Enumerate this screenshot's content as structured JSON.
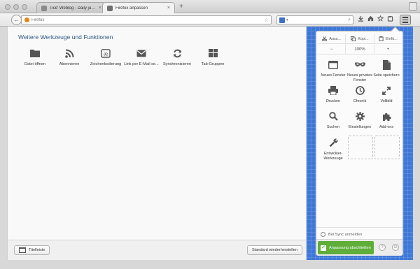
{
  "window": {
    "tabs": [
      {
        "label": "Tice' Weblog - Daily junk ...",
        "close": "×"
      },
      {
        "label": "Firefox anpassen",
        "close": "×"
      }
    ],
    "new_tab": "+"
  },
  "toolbar": {
    "back": "←",
    "url_placeholder": "Firefox",
    "bookmark_star": "☆",
    "search_caret": "▾",
    "search_glass": "⌕",
    "icons": [
      "download-icon",
      "home-icon",
      "bookmark-icon",
      "reading-list-icon"
    ]
  },
  "palette": {
    "title": "Weitere Werkzeuge und Funktionen",
    "tools": [
      {
        "label": "Datei öffnen",
        "icon": "folder-icon"
      },
      {
        "label": "Abonnieren",
        "icon": "rss-icon"
      },
      {
        "label": "Zeichenkodierung",
        "icon": "encoding-icon"
      },
      {
        "label": "Link per E-Mail se...",
        "icon": "mail-icon"
      },
      {
        "label": "Synchronisieren",
        "icon": "sync-icon"
      },
      {
        "label": "Tab-Gruppen",
        "icon": "tab-groups-icon"
      }
    ]
  },
  "footer": {
    "title_bar_label": "Titelleiste",
    "restore_defaults_label": "Standard wiederherstellen"
  },
  "panel": {
    "edit": {
      "cut": "Auss...",
      "copy": "Kopi...",
      "paste": "Einfü..."
    },
    "zoom": {
      "out": "−",
      "level": "100%",
      "in": "+"
    },
    "items": [
      {
        "label": "Neues Fenster",
        "icon": "new-window-icon"
      },
      {
        "label": "Neues privates Fenster",
        "icon": "private-window-icon"
      },
      {
        "label": "Seite speichern",
        "icon": "save-page-icon"
      },
      {
        "label": "Drucken",
        "icon": "print-icon"
      },
      {
        "label": "Chronik",
        "icon": "history-icon"
      },
      {
        "label": "Vollbild",
        "icon": "fullscreen-icon"
      },
      {
        "label": "Suchen",
        "icon": "search-icon"
      },
      {
        "label": "Einstellungen",
        "icon": "settings-icon"
      },
      {
        "label": "Add-ons",
        "icon": "addons-icon"
      },
      {
        "label": "Entwickler-Werkzeuge",
        "icon": "developer-icon"
      }
    ],
    "sync_label": "Bei Sync anmelden",
    "done_label": "Anpassung abschließen",
    "help": "?",
    "power": "⏻"
  },
  "colors": {
    "accent_blue": "#3d78d8",
    "done_green": "#5fae3a",
    "title_blue": "#2c5a86"
  }
}
